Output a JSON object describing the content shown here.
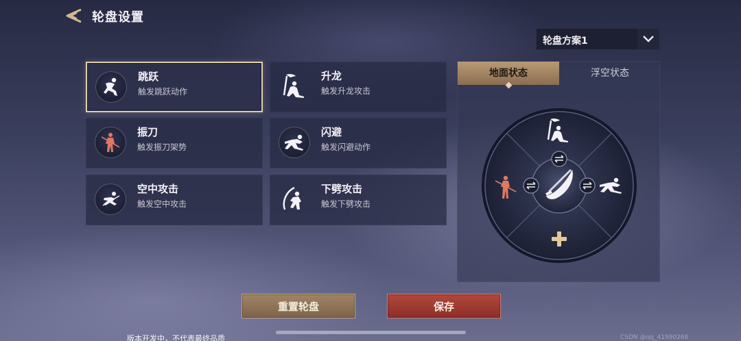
{
  "header": {
    "title": "轮盘设置"
  },
  "scheme": {
    "label": "轮盘方案1"
  },
  "skills": [
    {
      "name": "跳跃",
      "desc": "触发跳跃动作",
      "icon": "jump-icon",
      "selected": true
    },
    {
      "name": "升龙",
      "desc": "触发升龙攻击",
      "icon": "rising-dragon-icon"
    },
    {
      "name": "振刀",
      "desc": "触发振刀架势",
      "icon": "blade-parry-icon"
    },
    {
      "name": "闪避",
      "desc": "触发闪避动作",
      "icon": "dodge-icon"
    },
    {
      "name": "空中攻击",
      "desc": "触发空中攻击",
      "icon": "air-attack-icon"
    },
    {
      "name": "下劈攻击",
      "desc": "触发下劈攻击",
      "icon": "downward-slash-icon"
    }
  ],
  "tabs": [
    {
      "label": "地面状态",
      "active": true
    },
    {
      "label": "浮空状态",
      "active": false
    }
  ],
  "wheel": {
    "top": "rising-dragon-icon",
    "left": "blade-parry-icon",
    "right": "dodge-icon",
    "bottom": "add-slot-icon",
    "center": "weapon-icon"
  },
  "buttons": {
    "reset": "重置轮盘",
    "save": "保存"
  },
  "footer": {
    "note": "版本开发中，不代表最终品质",
    "watermark": "CSDN @qq_41990268"
  },
  "colors": {
    "accent": "#b99a76",
    "save": "#a23b31",
    "parry": "#e07862"
  }
}
